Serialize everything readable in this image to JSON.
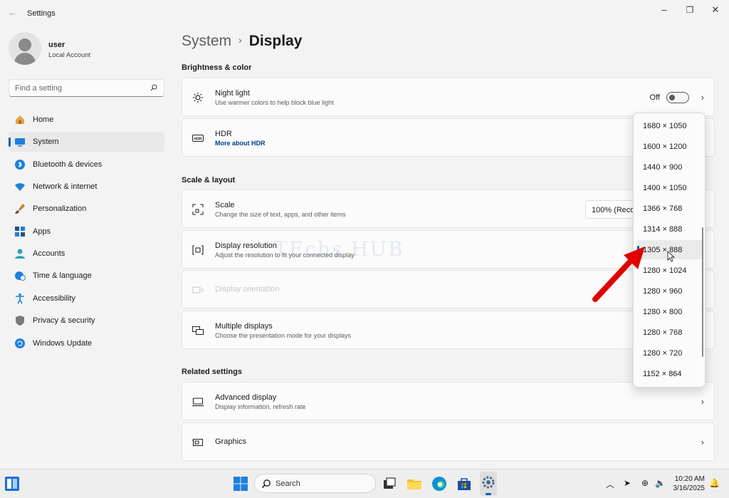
{
  "window": {
    "title": "Settings",
    "minimize": "–",
    "maximize": "❐",
    "close": "✕",
    "back": "←"
  },
  "user": {
    "name": "user",
    "account": "Local Account"
  },
  "search": {
    "placeholder": "Find a setting"
  },
  "nav": [
    {
      "label": "Home",
      "icon": "home-icon"
    },
    {
      "label": "System",
      "icon": "system-icon",
      "active": true
    },
    {
      "label": "Bluetooth & devices",
      "icon": "bluetooth-icon"
    },
    {
      "label": "Network & internet",
      "icon": "wifi-icon"
    },
    {
      "label": "Personalization",
      "icon": "brush-icon"
    },
    {
      "label": "Apps",
      "icon": "apps-icon"
    },
    {
      "label": "Accounts",
      "icon": "accounts-icon"
    },
    {
      "label": "Time & language",
      "icon": "globe-clock-icon"
    },
    {
      "label": "Accessibility",
      "icon": "accessibility-icon"
    },
    {
      "label": "Privacy & security",
      "icon": "shield-icon"
    },
    {
      "label": "Windows Update",
      "icon": "update-icon"
    }
  ],
  "breadcrumb": {
    "parent": "System",
    "separator": "›",
    "current": "Display"
  },
  "sections": {
    "brightness": "Brightness & color",
    "scale_layout": "Scale & layout",
    "related": "Related settings"
  },
  "cards": {
    "night_light": {
      "title": "Night light",
      "subtitle": "Use warmer colors to help block blue light",
      "state": "Off"
    },
    "hdr": {
      "title": "HDR",
      "link": "More about HDR"
    },
    "scale": {
      "title": "Scale",
      "subtitle": "Change the size of text, apps, and other items",
      "value": "100% (Recommended)"
    },
    "resolution": {
      "title": "Display resolution",
      "subtitle": "Adjust the resolution to fit your connected display"
    },
    "orientation": {
      "title": "Display orientation"
    },
    "multiple": {
      "title": "Multiple displays",
      "subtitle": "Choose the presentation mode for your displays"
    },
    "advanced": {
      "title": "Advanced display",
      "subtitle": "Display information, refresh rate"
    },
    "graphics": {
      "title": "Graphics"
    }
  },
  "watermark": "TEchs HUB",
  "resolution_options": [
    "1680 × 1050",
    "1600 × 1200",
    "1440 × 900",
    "1400 × 1050",
    "1366 × 768",
    "1314 × 888",
    "1305 × 888",
    "1280 × 1024",
    "1280 × 960",
    "1280 × 800",
    "1280 × 768",
    "1280 × 720",
    "1152 × 864"
  ],
  "selected_resolution": "1305 × 888",
  "colors": {
    "accent": "#005fb8",
    "arrow": "#e00000"
  },
  "taskbar": {
    "search_placeholder": "Search",
    "time": "10:20 AM",
    "date": "3/16/2025"
  }
}
